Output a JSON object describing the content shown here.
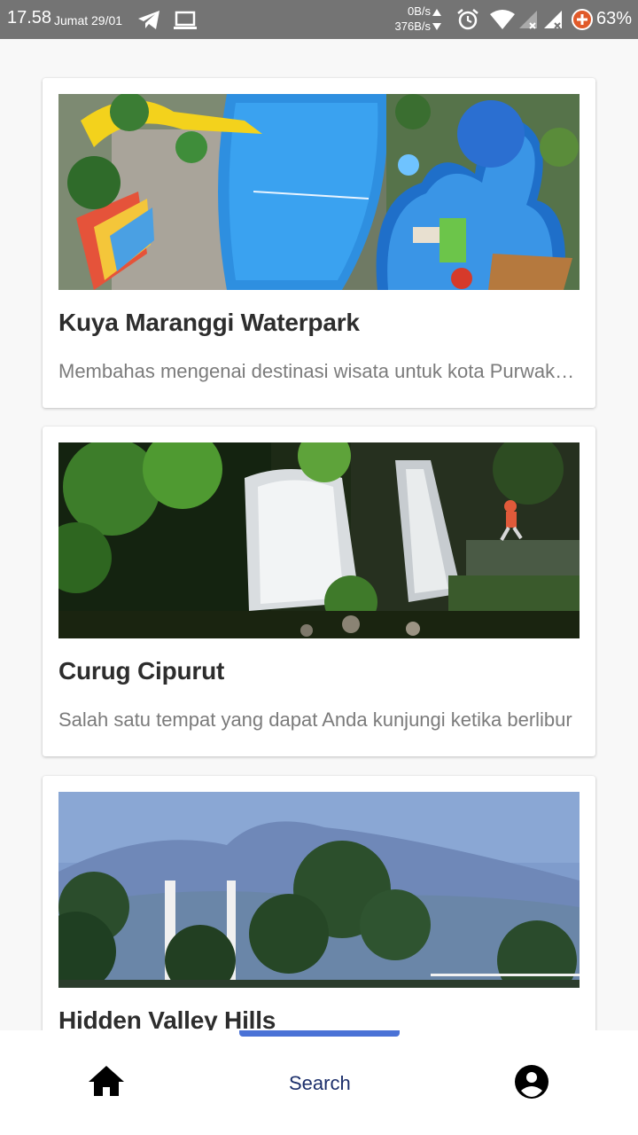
{
  "status_bar": {
    "time": "17.58",
    "date": "Jumat 29/01",
    "net_up": "0B/s",
    "net_down": "376B/s",
    "battery": "63%",
    "icons": [
      "telegram-icon",
      "laptop-icon",
      "alarm-icon",
      "wifi-icon",
      "signal-icon",
      "signal-icon",
      "battery-saver-icon"
    ]
  },
  "cards": [
    {
      "title": "Kuya Maranggi Waterpark",
      "description": "Membahas mengenai destinasi wisata untuk kota Purwakarta",
      "image": "waterpark-aerial-photo"
    },
    {
      "title": "Curug Cipurut",
      "description": "Salah satu tempat yang dapat Anda kunjungi ketika berlibur",
      "image": "waterfall-photo"
    },
    {
      "title": "Hidden Valley Hills",
      "description": "",
      "image": "valley-hills-photo"
    }
  ],
  "bottom_nav": {
    "home_icon": "home-icon",
    "search_label": "Search",
    "account_icon": "account-circle-icon",
    "active_color": "#4a72d6"
  }
}
